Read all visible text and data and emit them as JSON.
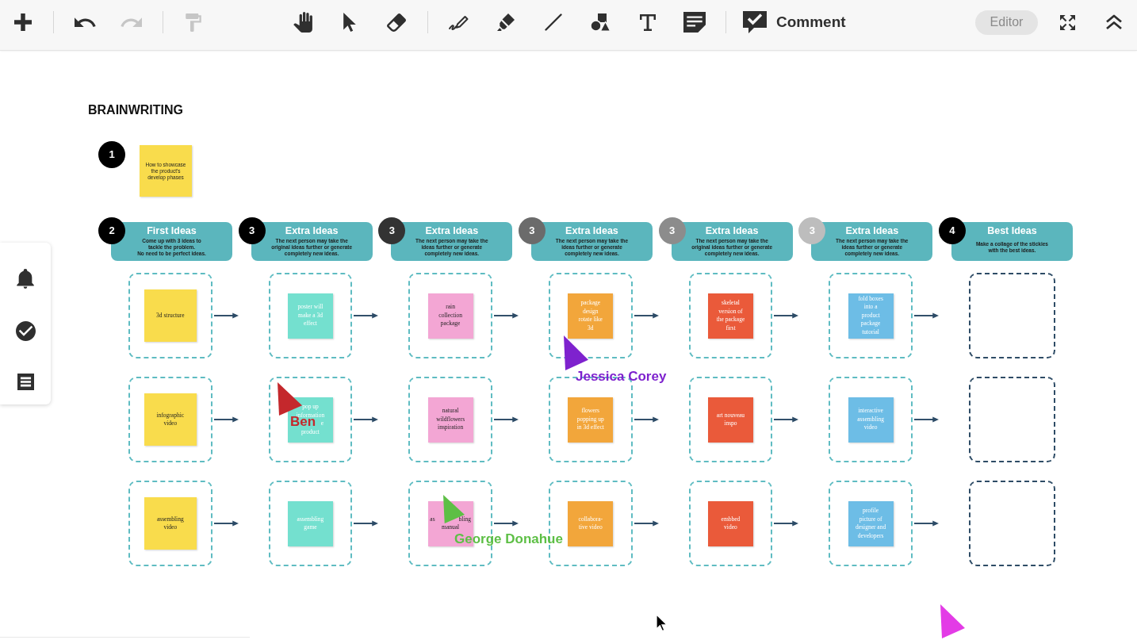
{
  "toolbar": {
    "undo": {
      "disabled": false
    },
    "redo": {
      "disabled": true
    },
    "paint_format": {
      "disabled": true
    },
    "comment_label": "Comment",
    "role_label": "Editor"
  },
  "board": {
    "title": "BRAINWRITING",
    "prompt": {
      "badge": {
        "label": "1",
        "color": "#000000"
      },
      "text": "How to showcase\nthe product's\ndevelop phases",
      "color": "#f9dc4c"
    },
    "columns": [
      {
        "kind": "first",
        "badge": {
          "label": "2",
          "color": "#000000"
        },
        "title": "First Ideas",
        "description": "Come up with 3 ideas to\ntackle the problem.\nNo need to be perfect ideas.",
        "cells": [
          {
            "kind": "sticky",
            "text": "3d structure",
            "color": "#f9dc4c"
          },
          {
            "kind": "sticky",
            "text": "infographic\nvideo",
            "color": "#f9dc4c"
          },
          {
            "kind": "sticky",
            "text": "assembling\nvideo",
            "color": "#f9dc4c"
          }
        ]
      },
      {
        "kind": "extra",
        "badge": {
          "label": "3",
          "color": "#000000"
        },
        "title": "Extra Ideas",
        "description": "The next person may take the\noriginal ideas further or generate\ncompletely new ideas.",
        "cells": [
          {
            "kind": "sticky",
            "text": "poster will\nmake a 3d\neffect",
            "color": "#74e0cf"
          },
          {
            "kind": "sticky",
            "text": "pop up\ninformation\n    e\nproduct",
            "color": "#74e0cf"
          },
          {
            "kind": "sticky",
            "text": "assembling\ngame",
            "color": "#74e0cf"
          }
        ]
      },
      {
        "kind": "extra",
        "badge": {
          "label": "3",
          "color": "#333333"
        },
        "title": "Extra Ideas",
        "description": "The next person may take the\nideas further or generate\ncompletely new ideas.",
        "cells": [
          {
            "kind": "sticky",
            "text": "rain\ncollection\npackage",
            "color": "#f3a6d4"
          },
          {
            "kind": "sticky",
            "text": "natural\nwildflowers\ninspiration",
            "color": "#f3a6d4"
          },
          {
            "kind": "sticky",
            "text": "as    bling\nmanual",
            "color": "#f3a6d4"
          }
        ]
      },
      {
        "kind": "extra",
        "badge": {
          "label": "3",
          "color": "#6b6b6b"
        },
        "title": "Extra Ideas",
        "description": "The next person may take the\nideas further or generate\ncompletely new ideas.",
        "cells": [
          {
            "kind": "sticky",
            "text": "package\ndesign\nrotate like\n3d",
            "color": "#f2a63b"
          },
          {
            "kind": "sticky",
            "text": "flowers\npopping up\nin 3d effect",
            "color": "#f2a63b"
          },
          {
            "kind": "sticky",
            "text": "collabora-\ntive video",
            "color": "#f2a63b"
          }
        ]
      },
      {
        "kind": "extra",
        "badge": {
          "label": "3",
          "color": "#8c8c8c"
        },
        "title": "Extra Ideas",
        "description": "The next person may take the\noriginal ideas further or generate\ncompletely new ideas.",
        "cells": [
          {
            "kind": "sticky",
            "text": "skeletal\nversion of\nthe package\nfirst",
            "color": "#ea5a3a"
          },
          {
            "kind": "sticky",
            "text": "art nouveau\ninspo",
            "color": "#ea5a3a"
          },
          {
            "kind": "sticky",
            "text": "embbed\nvideo",
            "color": "#ea5a3a"
          }
        ]
      },
      {
        "kind": "extra",
        "badge": {
          "label": "3",
          "color": "#bdbdbd"
        },
        "title": "Extra Ideas",
        "description": "The next person may take the\nideas further or generate\ncompletely new ideas.",
        "cells": [
          {
            "kind": "sticky",
            "text": "fold boxes\ninto a\nproduct\npackage\ntutorial",
            "color": "#6dbde6"
          },
          {
            "kind": "sticky",
            "text": "interactive\nassembling\nvideo",
            "color": "#6dbde6"
          },
          {
            "kind": "sticky",
            "text": "profile\npicture of\ndesigner and\ndevelopers",
            "color": "#6dbde6"
          }
        ]
      },
      {
        "kind": "best",
        "badge": {
          "label": "4",
          "color": "#000000"
        },
        "title": "Best Ideas",
        "description": "Make a collage of the stickies\nwith the best ideas.",
        "cells": [
          {
            "kind": "empty"
          },
          {
            "kind": "empty"
          },
          {
            "kind": "empty"
          }
        ]
      }
    ]
  },
  "cursors": [
    {
      "name": "Jessica Corey",
      "color": "#7e22ce"
    },
    {
      "name": "Ben",
      "color": "#c4282c"
    },
    {
      "name": "George Donahue",
      "color": "#5dbf45"
    },
    {
      "color": "#e33be6"
    }
  ]
}
